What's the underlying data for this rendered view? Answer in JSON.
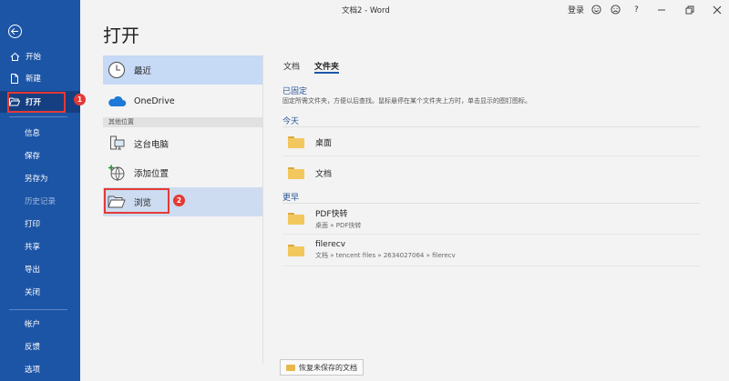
{
  "window": {
    "title": "文档2  -  Word",
    "login": "登录",
    "help": "?"
  },
  "nav": {
    "items": [
      {
        "label": "开始",
        "icon": "home-icon"
      },
      {
        "label": "新建",
        "icon": "new-doc-icon"
      },
      {
        "label": "打开",
        "icon": "open-folder-icon"
      },
      {
        "label": "信息"
      },
      {
        "label": "保存"
      },
      {
        "label": "另存为"
      },
      {
        "label": "历史记录"
      },
      {
        "label": "打印"
      },
      {
        "label": "共享"
      },
      {
        "label": "导出"
      },
      {
        "label": "关闭"
      },
      {
        "label": "帐户"
      },
      {
        "label": "反馈"
      },
      {
        "label": "选项"
      }
    ]
  },
  "page": {
    "title": "打开"
  },
  "locations": {
    "recent": "最近",
    "onedrive": "OneDrive",
    "other_header": "其他位置",
    "this_pc": "这台电脑",
    "add_place": "添加位置",
    "browse": "浏览"
  },
  "badges": {
    "one": "1",
    "two": "2"
  },
  "tabs": {
    "documents": "文档",
    "folders": "文件夹"
  },
  "sections": {
    "pinned": "已固定",
    "pinned_desc": "固定所需文件夹，方便以后查找。鼠标悬停在某个文件夹上方时，单击显示的图钉图标。",
    "today": "今天",
    "earlier": "更早"
  },
  "folders_today": [
    {
      "name": "桌面"
    },
    {
      "name": "文档"
    }
  ],
  "folders_earlier": [
    {
      "name": "PDF快转",
      "path": "桌面 » PDF快转"
    },
    {
      "name": "filerecv",
      "path": "文档 » tencent files » 2634027064 » filerecv"
    }
  ],
  "recover_button": "恢复未保存的文档",
  "colors": {
    "nav_bg": "#1d55a6",
    "accent": "#2b5797",
    "highlight": "#e53935"
  }
}
